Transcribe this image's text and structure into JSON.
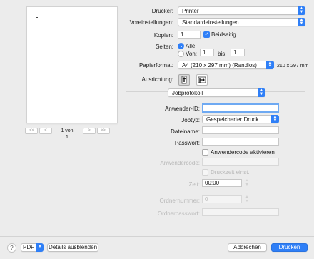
{
  "preview": {
    "page_label": "1 von 1",
    "first_label": "|<<",
    "prev_label": "<",
    "next_label": ">",
    "last_label": ">>|"
  },
  "printer": {
    "label": "Drucker:",
    "value": "Printer"
  },
  "presets": {
    "label": "Voreinstellungen:",
    "value": "Standardeinstellungen"
  },
  "copies": {
    "label": "Kopien:",
    "value": "1",
    "duplex_label": "Beidseitig",
    "duplex_checked": true
  },
  "pages": {
    "label": "Seiten:",
    "all_label": "Alle",
    "from_label": "Von:",
    "from_value": "1",
    "to_label": "bis:",
    "to_value": "1"
  },
  "paper": {
    "label": "Papierformat:",
    "value": "A4 (210 x 297 mm) (Randlos)",
    "size_text": "210 x 297 mm"
  },
  "orientation": {
    "label": "Ausrichtung:"
  },
  "section": {
    "value": "Jobprotokoll"
  },
  "job": {
    "user_id_label": "Anwender-ID:",
    "user_id_value": "",
    "jobtype_label": "Jobtyp:",
    "jobtype_value": "Gespeicherter Druck",
    "filename_label": "Dateiname:",
    "filename_value": "",
    "password_label": "Passwort:",
    "password_value": "",
    "usercode_checkbox_label": "Anwendercode aktivieren",
    "usercode_label": "Anwendercode:",
    "usercode_value": "",
    "print_time_label": "Druckzeit einst.",
    "time_label": "Zeit:",
    "time_value": "00:00",
    "order_number_label": "Ordnernummer:",
    "order_number_value": "0",
    "order_password_label": "Ordnerpasswort:",
    "order_password_value": ""
  },
  "footer": {
    "help_label": "?",
    "pdf_label": "PDF",
    "details_label": "Details ausblenden",
    "cancel_label": "Abbrechen",
    "print_label": "Drucken"
  },
  "colors": {
    "accent": "#2f7ff7",
    "background": "#ececec"
  }
}
